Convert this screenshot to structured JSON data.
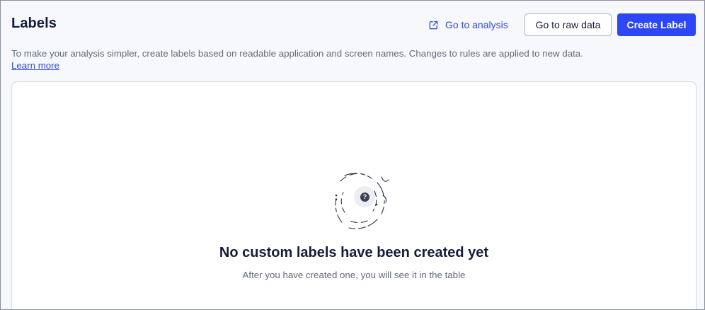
{
  "header": {
    "title": "Labels",
    "analysis_link_label": "Go to analysis",
    "raw_data_button_label": "Go to raw data",
    "create_button_label": "Create Label"
  },
  "description": {
    "text": "To make your analysis simpler, create labels based on readable application and screen names. Changes to rules are applied to new data.",
    "learn_more_label": "Learn more"
  },
  "empty_state": {
    "icon": "question-mark-icon",
    "title": "No custom labels have been created yet",
    "subtitle": "After you have created one, you will see it in the table"
  },
  "colors": {
    "primary": "#2d47f5",
    "link": "#2f4bd8",
    "heading": "#141c3a",
    "muted_text": "#626a7a",
    "background": "#f7f8fb"
  }
}
